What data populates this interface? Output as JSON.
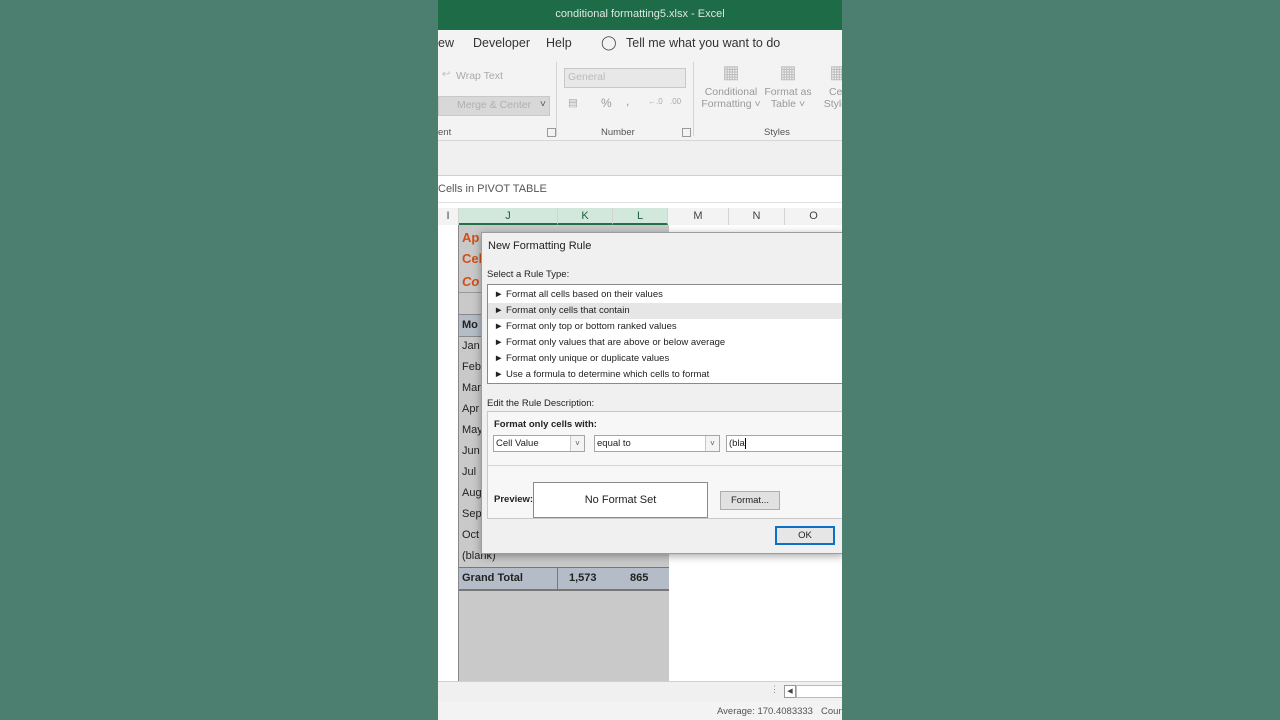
{
  "window": {
    "title": "conditional formatting5.xlsx  -  Excel"
  },
  "menu": {
    "items": [
      "ew",
      "Developer",
      "Help"
    ],
    "tell_me": "Tell me what you want to do"
  },
  "ribbon": {
    "wrap_text": "Wrap Text",
    "merge_center": "Merge & Center",
    "alignment_group": "ent",
    "number_format": "General",
    "percent": "%",
    "comma": ",",
    "number_group": "Number",
    "conditional_formatting_1": "Conditional",
    "conditional_formatting_2": "Formatting ˅",
    "format_as_table_1": "Format as",
    "format_as_table_2": "Table ˅",
    "cell_styles_1": "Cell",
    "cell_styles_2": "Styles",
    "styles_group": "Styles"
  },
  "sheet": {
    "title": "Cells in PIVOT TABLE",
    "columns": [
      "I",
      "J",
      "K",
      "L",
      "M",
      "N",
      "O"
    ],
    "heading_partial": [
      "Ap",
      "Cel",
      "Co"
    ],
    "rows": [
      "Mo",
      "Jan",
      "Feb",
      "Mar",
      "Apr",
      "May",
      "Jun",
      "Jul",
      "Aug",
      "Sep",
      "Oct",
      "(blank)"
    ],
    "grand_total": {
      "label": "Grand Total",
      "k": "1,573",
      "l": "865"
    }
  },
  "dialog": {
    "title": "New Formatting Rule",
    "select_label": "Select a Rule Type:",
    "rule_types": [
      "► Format all cells based on their values",
      "► Format only cells that contain",
      "► Format only top or bottom ranked values",
      "► Format only values that are above or below average",
      "► Format only unique or duplicate values",
      "► Use a formula to determine which cells to format"
    ],
    "selected_rule_index": 1,
    "edit_label": "Edit the Rule Description:",
    "format_only_label": "Format only cells with:",
    "condition_1": "Cell Value",
    "condition_2": "equal to",
    "value_input": "(bla",
    "preview_label": "Preview:",
    "preview_text": "No Format Set",
    "format_button": "Format...",
    "ok_button": "OK"
  },
  "status": {
    "average": "Average: 170.4083333",
    "count": "Coun"
  },
  "colors": {
    "excel_green": "#1e6b47",
    "selection_blue": "#0b70c8",
    "accent_orange": "#d04f18"
  }
}
